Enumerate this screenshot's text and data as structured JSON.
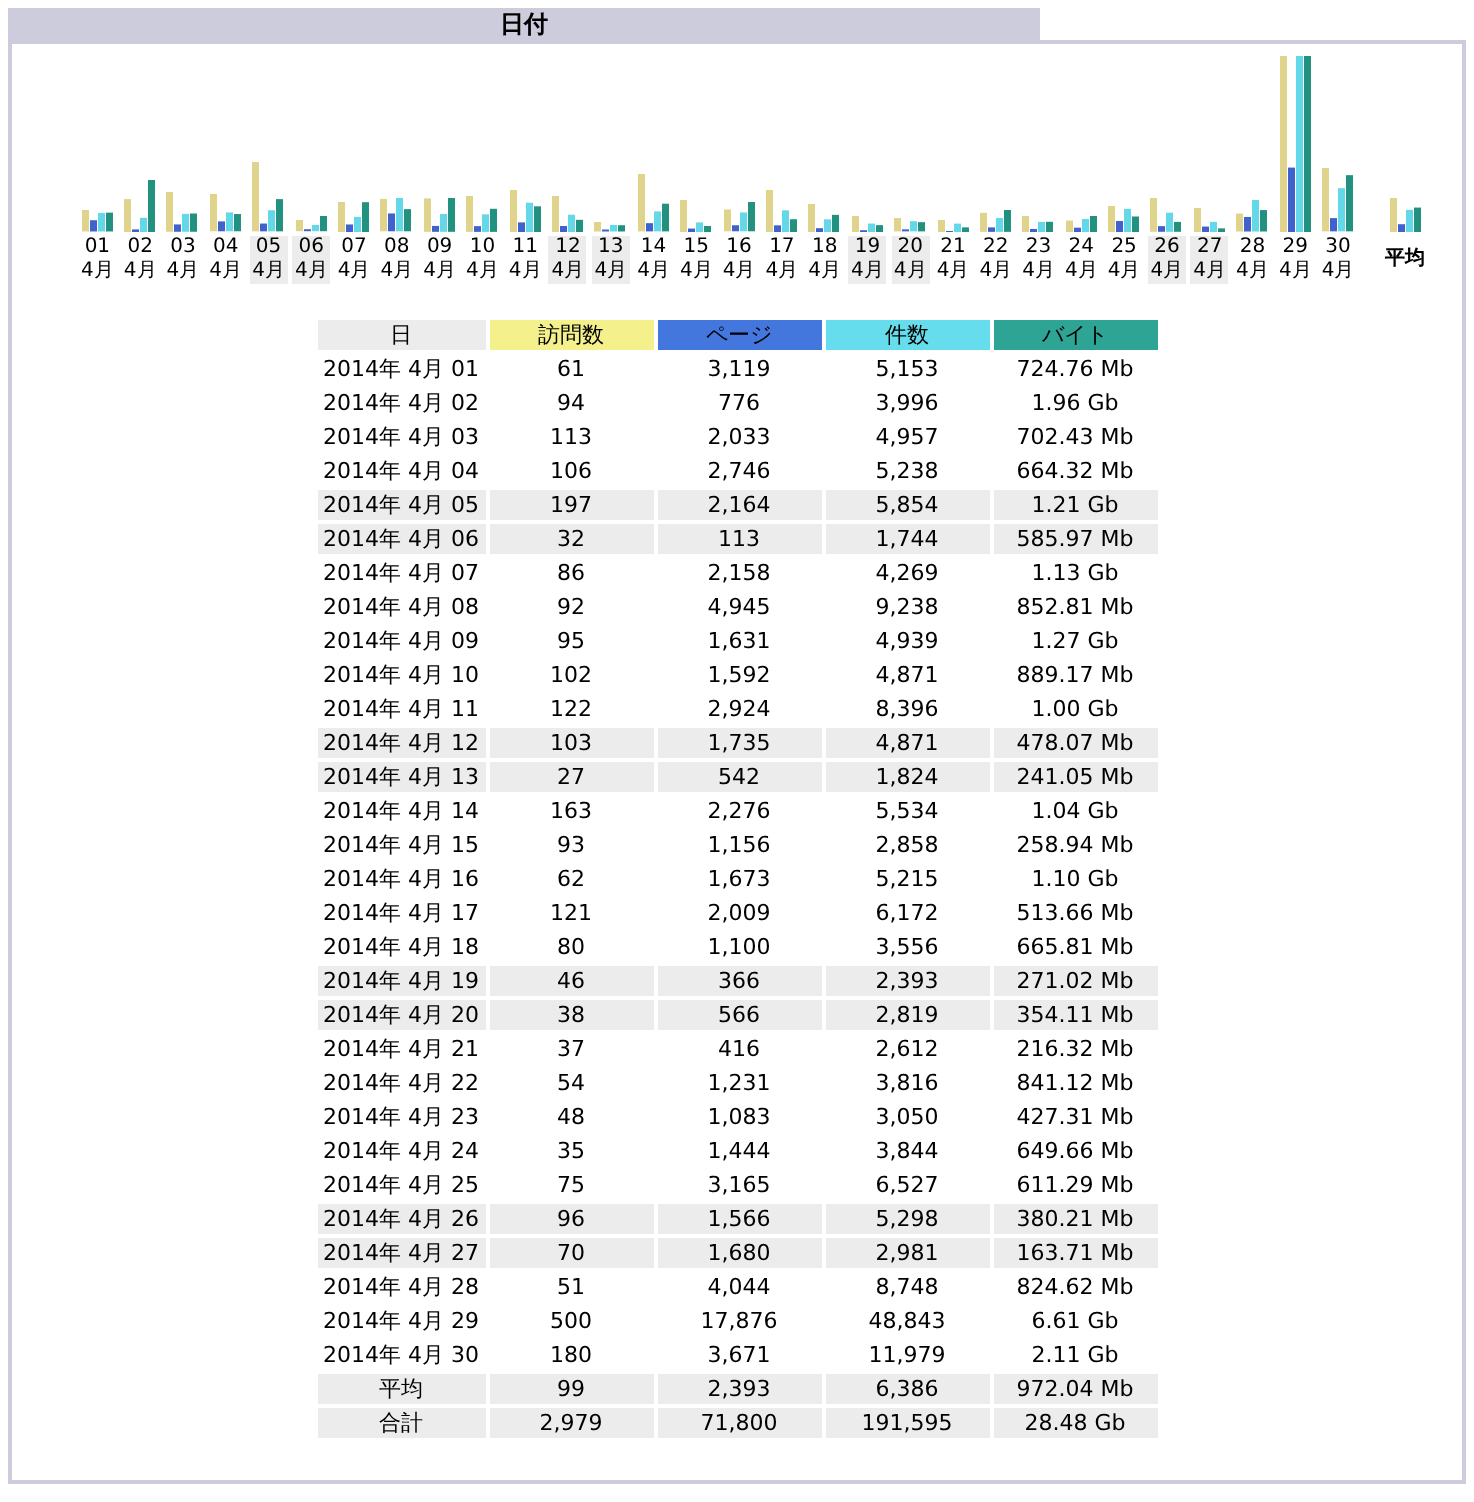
{
  "title": "日付",
  "chart": {
    "days": [
      {
        "day": "01",
        "month": "4月",
        "weekend": false
      },
      {
        "day": "02",
        "month": "4月",
        "weekend": false
      },
      {
        "day": "03",
        "month": "4月",
        "weekend": false
      },
      {
        "day": "04",
        "month": "4月",
        "weekend": false
      },
      {
        "day": "05",
        "month": "4月",
        "weekend": true
      },
      {
        "day": "06",
        "month": "4月",
        "weekend": true
      },
      {
        "day": "07",
        "month": "4月",
        "weekend": false
      },
      {
        "day": "08",
        "month": "4月",
        "weekend": false
      },
      {
        "day": "09",
        "month": "4月",
        "weekend": false
      },
      {
        "day": "10",
        "month": "4月",
        "weekend": false
      },
      {
        "day": "11",
        "month": "4月",
        "weekend": false
      },
      {
        "day": "12",
        "month": "4月",
        "weekend": true
      },
      {
        "day": "13",
        "month": "4月",
        "weekend": true
      },
      {
        "day": "14",
        "month": "4月",
        "weekend": false
      },
      {
        "day": "15",
        "month": "4月",
        "weekend": false
      },
      {
        "day": "16",
        "month": "4月",
        "weekend": false
      },
      {
        "day": "17",
        "month": "4月",
        "weekend": false
      },
      {
        "day": "18",
        "month": "4月",
        "weekend": false
      },
      {
        "day": "19",
        "month": "4月",
        "weekend": true
      },
      {
        "day": "20",
        "month": "4月",
        "weekend": true
      },
      {
        "day": "21",
        "month": "4月",
        "weekend": false
      },
      {
        "day": "22",
        "month": "4月",
        "weekend": false
      },
      {
        "day": "23",
        "month": "4月",
        "weekend": false
      },
      {
        "day": "24",
        "month": "4月",
        "weekend": false
      },
      {
        "day": "25",
        "month": "4月",
        "weekend": false
      },
      {
        "day": "26",
        "month": "4月",
        "weekend": true
      },
      {
        "day": "27",
        "month": "4月",
        "weekend": true
      },
      {
        "day": "28",
        "month": "4月",
        "weekend": false
      },
      {
        "day": "29",
        "month": "4月",
        "weekend": false
      },
      {
        "day": "30",
        "month": "4月",
        "weekend": false
      }
    ],
    "average_label": "平均"
  },
  "table": {
    "columns": [
      {
        "label": "日",
        "color": "#ececec"
      },
      {
        "label": "訪問数",
        "color": "#f4f08c"
      },
      {
        "label": "ページ",
        "color": "#4477dd"
      },
      {
        "label": "件数",
        "color": "#66dded"
      },
      {
        "label": "バイト",
        "color": "#2ea495"
      }
    ],
    "rows": [
      {
        "weekend": false,
        "cells": [
          "2014年 4月 01",
          "61",
          "3,119",
          "5,153",
          "724.76 Mb"
        ]
      },
      {
        "weekend": false,
        "cells": [
          "2014年 4月 02",
          "94",
          "776",
          "3,996",
          "1.96 Gb"
        ]
      },
      {
        "weekend": false,
        "cells": [
          "2014年 4月 03",
          "113",
          "2,033",
          "4,957",
          "702.43 Mb"
        ]
      },
      {
        "weekend": false,
        "cells": [
          "2014年 4月 04",
          "106",
          "2,746",
          "5,238",
          "664.32 Mb"
        ]
      },
      {
        "weekend": true,
        "cells": [
          "2014年 4月 05",
          "197",
          "2,164",
          "5,854",
          "1.21 Gb"
        ]
      },
      {
        "weekend": true,
        "cells": [
          "2014年 4月 06",
          "32",
          "113",
          "1,744",
          "585.97 Mb"
        ]
      },
      {
        "weekend": false,
        "cells": [
          "2014年 4月 07",
          "86",
          "2,158",
          "4,269",
          "1.13 Gb"
        ]
      },
      {
        "weekend": false,
        "cells": [
          "2014年 4月 08",
          "92",
          "4,945",
          "9,238",
          "852.81 Mb"
        ]
      },
      {
        "weekend": false,
        "cells": [
          "2014年 4月 09",
          "95",
          "1,631",
          "4,939",
          "1.27 Gb"
        ]
      },
      {
        "weekend": false,
        "cells": [
          "2014年 4月 10",
          "102",
          "1,592",
          "4,871",
          "889.17 Mb"
        ]
      },
      {
        "weekend": false,
        "cells": [
          "2014年 4月 11",
          "122",
          "2,924",
          "8,396",
          "1.00 Gb"
        ]
      },
      {
        "weekend": true,
        "cells": [
          "2014年 4月 12",
          "103",
          "1,735",
          "4,871",
          "478.07 Mb"
        ]
      },
      {
        "weekend": true,
        "cells": [
          "2014年 4月 13",
          "27",
          "542",
          "1,824",
          "241.05 Mb"
        ]
      },
      {
        "weekend": false,
        "cells": [
          "2014年 4月 14",
          "163",
          "2,276",
          "5,534",
          "1.04 Gb"
        ]
      },
      {
        "weekend": false,
        "cells": [
          "2014年 4月 15",
          "93",
          "1,156",
          "2,858",
          "258.94 Mb"
        ]
      },
      {
        "weekend": false,
        "cells": [
          "2014年 4月 16",
          "62",
          "1,673",
          "5,215",
          "1.10 Gb"
        ]
      },
      {
        "weekend": false,
        "cells": [
          "2014年 4月 17",
          "121",
          "2,009",
          "6,172",
          "513.66 Mb"
        ]
      },
      {
        "weekend": false,
        "cells": [
          "2014年 4月 18",
          "80",
          "1,100",
          "3,556",
          "665.81 Mb"
        ]
      },
      {
        "weekend": true,
        "cells": [
          "2014年 4月 19",
          "46",
          "366",
          "2,393",
          "271.02 Mb"
        ]
      },
      {
        "weekend": true,
        "cells": [
          "2014年 4月 20",
          "38",
          "566",
          "2,819",
          "354.11 Mb"
        ]
      },
      {
        "weekend": false,
        "cells": [
          "2014年 4月 21",
          "37",
          "416",
          "2,612",
          "216.32 Mb"
        ]
      },
      {
        "weekend": false,
        "cells": [
          "2014年 4月 22",
          "54",
          "1,231",
          "3,816",
          "841.12 Mb"
        ]
      },
      {
        "weekend": false,
        "cells": [
          "2014年 4月 23",
          "48",
          "1,083",
          "3,050",
          "427.31 Mb"
        ]
      },
      {
        "weekend": false,
        "cells": [
          "2014年 4月 24",
          "35",
          "1,444",
          "3,844",
          "649.66 Mb"
        ]
      },
      {
        "weekend": false,
        "cells": [
          "2014年 4月 25",
          "75",
          "3,165",
          "6,527",
          "611.29 Mb"
        ]
      },
      {
        "weekend": true,
        "cells": [
          "2014年 4月 26",
          "96",
          "1,566",
          "5,298",
          "380.21 Mb"
        ]
      },
      {
        "weekend": true,
        "cells": [
          "2014年 4月 27",
          "70",
          "1,680",
          "2,981",
          "163.71 Mb"
        ]
      },
      {
        "weekend": false,
        "cells": [
          "2014年 4月 28",
          "51",
          "4,044",
          "8,748",
          "824.62 Mb"
        ]
      },
      {
        "weekend": false,
        "cells": [
          "2014年 4月 29",
          "500",
          "17,876",
          "48,843",
          "6.61 Gb"
        ]
      },
      {
        "weekend": false,
        "cells": [
          "2014年 4月 30",
          "180",
          "3,671",
          "11,979",
          "2.11 Gb"
        ]
      }
    ],
    "summary_rows": [
      {
        "cells": [
          "平均",
          "99",
          "2,393",
          "6,386",
          "972.04 Mb"
        ]
      },
      {
        "cells": [
          "合計",
          "2,979",
          "71,800",
          "191,595",
          "28.48 Gb"
        ]
      }
    ]
  }
}
